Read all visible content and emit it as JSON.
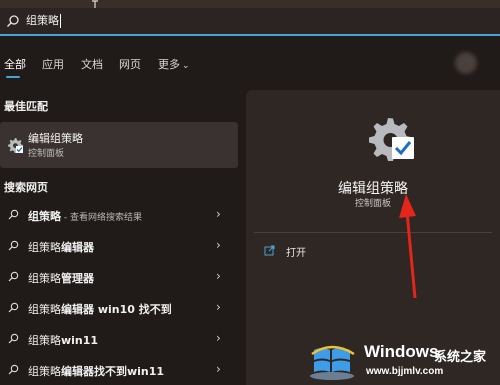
{
  "search": {
    "value": "组策略"
  },
  "tabs": [
    {
      "label": "全部"
    },
    {
      "label": "应用"
    },
    {
      "label": "文档"
    },
    {
      "label": "网页"
    },
    {
      "label": "更多"
    }
  ],
  "best_match": {
    "section_title": "最佳匹配",
    "name": "编辑组策略",
    "subtitle": "控制面板"
  },
  "web_search": {
    "section_title": "搜索网页",
    "items": [
      {
        "bold": "组策略",
        "rest": "",
        "muted": " - 查看网络搜索结果"
      },
      {
        "bold": "组策略",
        "rest": "编辑器",
        "muted": ""
      },
      {
        "bold": "组策略",
        "rest": "管理器",
        "muted": ""
      },
      {
        "bold": "组策略",
        "rest": "编辑器 win10 找不到",
        "muted": ""
      },
      {
        "bold": "组策略",
        "rest": "win11",
        "muted": ""
      },
      {
        "bold": "组策略",
        "rest": "编辑器找不到win11",
        "muted": ""
      }
    ]
  },
  "details": {
    "title": "编辑组策略",
    "subtitle": "控制面板",
    "open_label": "打开"
  },
  "watermark": {
    "brand": "Windows",
    "brand_cn": "系统之家",
    "url": "www.bjjmlv.com"
  },
  "colors": {
    "accent": "#4aa3d6",
    "arrow": "#e3251c"
  }
}
